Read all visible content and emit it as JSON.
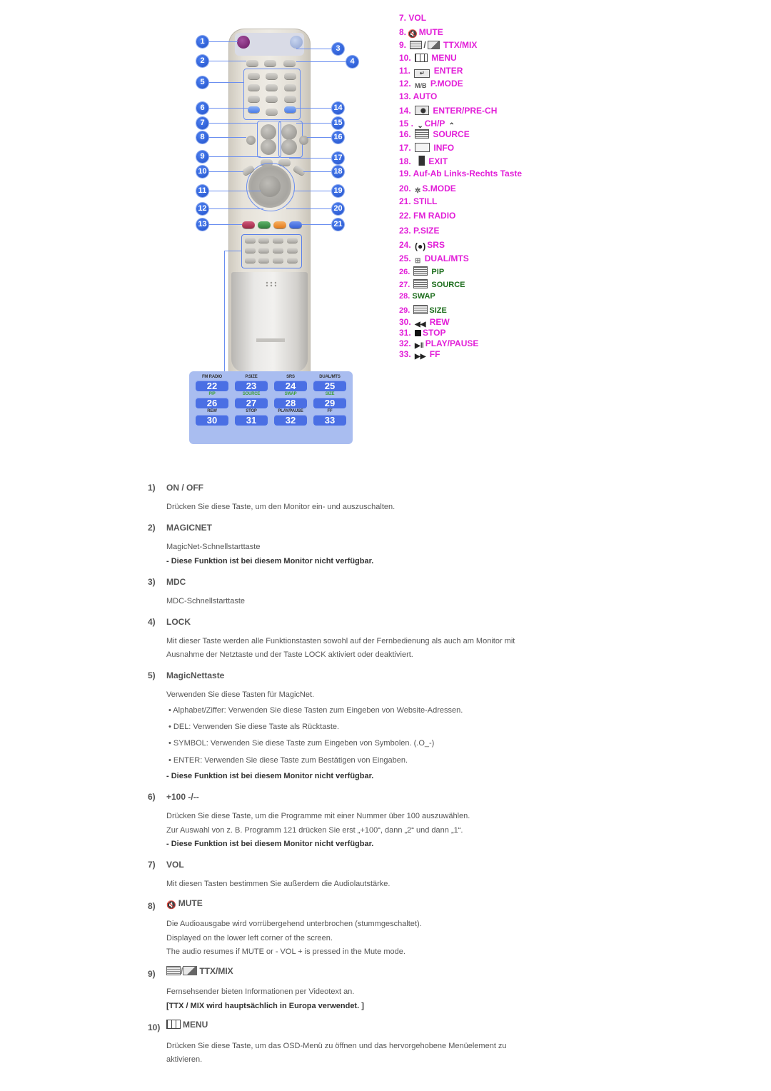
{
  "remote": {
    "callouts": [
      "1",
      "2",
      "3",
      "4",
      "5",
      "6",
      "7",
      "8",
      "9",
      "10",
      "11",
      "12",
      "13",
      "14",
      "15",
      "16",
      "17",
      "18",
      "19",
      "20",
      "21"
    ],
    "key_table": {
      "rows": [
        {
          "labels": [
            "FM RADIO",
            "P.SIZE",
            "SRS",
            "DUAL/MTS"
          ],
          "keys": [
            "22",
            "23",
            "24",
            "25"
          ],
          "label_color": "default"
        },
        {
          "labels": [
            "PIP",
            "SOURCE",
            "SWAP",
            "SIZE"
          ],
          "keys": [
            "26",
            "27",
            "28",
            "29"
          ],
          "label_color": "green"
        },
        {
          "labels": [
            "REW",
            "STOP",
            "PLAY/PAUSE",
            "FF"
          ],
          "keys": [
            "30",
            "31",
            "32",
            "33"
          ],
          "label_color": "default"
        }
      ]
    }
  },
  "legend": {
    "items": [
      {
        "num": "7.",
        "label": "VOL",
        "icon": null
      },
      {
        "num": "8.",
        "label": "MUTE",
        "icon": "mute-icon"
      },
      {
        "num": "9.",
        "label": "TTX/MIX",
        "icon": "ttx-mix-icon"
      },
      {
        "num": "10.",
        "label": "MENU",
        "icon": "menu-icon"
      },
      {
        "num": "11.",
        "label": "ENTER",
        "icon": "enter-icon"
      },
      {
        "num": "12.",
        "label": "P.MODE",
        "icon": "m-b-icon",
        "icon_text": "M/B"
      },
      {
        "num": "13.",
        "label": "AUTO",
        "icon": null
      },
      {
        "num": "14.",
        "label": "ENTER/PRE-CH",
        "icon": "pre-ch-icon"
      },
      {
        "num": "15 .",
        "label": "CH/P",
        "icon": "chevron-down-icon",
        "suffix_icon": "chevron-up-icon"
      },
      {
        "num": "16.",
        "label": "SOURCE",
        "icon": "source-icon"
      },
      {
        "num": "17.",
        "label": "INFO",
        "icon": "info-icon"
      },
      {
        "num": "18.",
        "label": "EXIT",
        "icon": "exit-icon"
      },
      {
        "num": "19.",
        "label": "Auf-Ab Links-Rechts Taste",
        "icon": null
      },
      {
        "num": "20.",
        "label": "S.MODE",
        "icon": "s-mode-icon"
      },
      {
        "num": "21.",
        "label": "STILL",
        "icon": null
      },
      {
        "num": "22.",
        "label": "FM RADIO",
        "icon": null
      },
      {
        "num": "23.",
        "label": "P.SIZE",
        "icon": null
      },
      {
        "num": "24.",
        "label": "SRS",
        "icon": "srs-icon"
      },
      {
        "num": "25.",
        "label": "DUAL/MTS",
        "icon": "dual-mts-icon"
      },
      {
        "num": "26.",
        "label": "PIP",
        "icon": "pip-icon",
        "color": "green"
      },
      {
        "num": "27.",
        "label": "SOURCE",
        "icon": "source-icon",
        "color": "green"
      },
      {
        "num": "28.",
        "label": "SWAP",
        "icon": null,
        "color": "green"
      },
      {
        "num": "29.",
        "label": "SIZE",
        "icon": "size-icon",
        "color": "green"
      },
      {
        "num": "30.",
        "label": "REW",
        "icon": "rewind-icon"
      },
      {
        "num": "31.",
        "label": "STOP",
        "icon": "stop-icon"
      },
      {
        "num": "32.",
        "label": "PLAY/PAUSE",
        "icon": "play-pause-icon"
      },
      {
        "num": "33.",
        "label": "FF",
        "icon": "fast-forward-icon"
      }
    ],
    "colors": {
      "magenta": "#e21ed8",
      "green": "#1c6d1c"
    }
  },
  "sections": [
    {
      "num": "1)",
      "title": "ON / OFF",
      "lines": [
        "Drücken Sie diese Taste, um den Monitor ein- und auszuschalten."
      ],
      "notes": []
    },
    {
      "num": "2)",
      "title": "MAGICNET",
      "lines": [
        "MagicNet-Schnellstarttaste"
      ],
      "notes": [
        "- Diese Funktion ist bei diesem Monitor nicht verfügbar."
      ]
    },
    {
      "num": "3)",
      "title": "MDC",
      "lines": [
        "MDC-Schnellstarttaste"
      ],
      "notes": []
    },
    {
      "num": "4)",
      "title": "LOCK",
      "lines": [
        "Mit dieser Taste werden alle Funktionstasten sowohl auf der Fernbedienung als auch am Monitor mit",
        "Ausnahme der Netztaste und der Taste LOCK aktiviert oder deaktiviert."
      ],
      "notes": []
    },
    {
      "num": "5)",
      "title": "MagicNettaste",
      "lines": [
        "Verwenden Sie diese Tasten für MagicNet."
      ],
      "bullets": [
        "• Alphabet/Ziffer: Verwenden Sie diese Tasten zum Eingeben von Website-Adressen.",
        "• DEL: Verwenden Sie diese Taste als Rücktaste.",
        "• SYMBOL: Verwenden Sie diese Taste zum Eingeben von Symbolen. (.O_-)",
        "• ENTER: Verwenden Sie diese Taste zum Bestätigen von Eingaben."
      ],
      "notes": [
        "- Diese Funktion ist bei diesem Monitor nicht verfügbar."
      ]
    },
    {
      "num": "6)",
      "title": "+100 -/--",
      "lines": [
        "Drücken Sie diese Taste, um die Programme mit einer Nummer über 100 auszuwählen.",
        "Zur Auswahl von z. B. Programm 121 drücken Sie erst „+100“, dann „2“ und dann „1“."
      ],
      "notes": [
        "- Diese Funktion ist bei diesem Monitor nicht verfügbar."
      ]
    },
    {
      "num": "7)",
      "title": "VOL",
      "lines": [
        "Mit diesen Tasten bestimmen Sie außerdem die Audiolautstärke."
      ],
      "notes": []
    },
    {
      "num": "8)",
      "title": "MUTE",
      "icon": "mute-icon",
      "lines": [
        "Die Audioausgabe wird vorrübergehend unterbrochen (stummgeschaltet).",
        "Displayed on the lower left corner of the screen.",
        "The audio resumes if MUTE or - VOL + is pressed in the Mute mode."
      ],
      "notes": []
    },
    {
      "num": "9)",
      "title": "TTX/MIX",
      "icon": "ttx-mix-icon",
      "lines": [
        "Fernsehsender bieten Informationen per Videotext an."
      ],
      "notes": [
        "[TTX / MIX wird hauptsächlich in Europa verwendet. ]"
      ]
    },
    {
      "num": "10)",
      "title": "MENU",
      "icon": "menu-icon",
      "lines": [
        "Drücken Sie diese Taste, um das OSD-Menü zu öffnen und das hervorgehobene Menüelement zu",
        "aktivieren."
      ],
      "notes": []
    }
  ]
}
